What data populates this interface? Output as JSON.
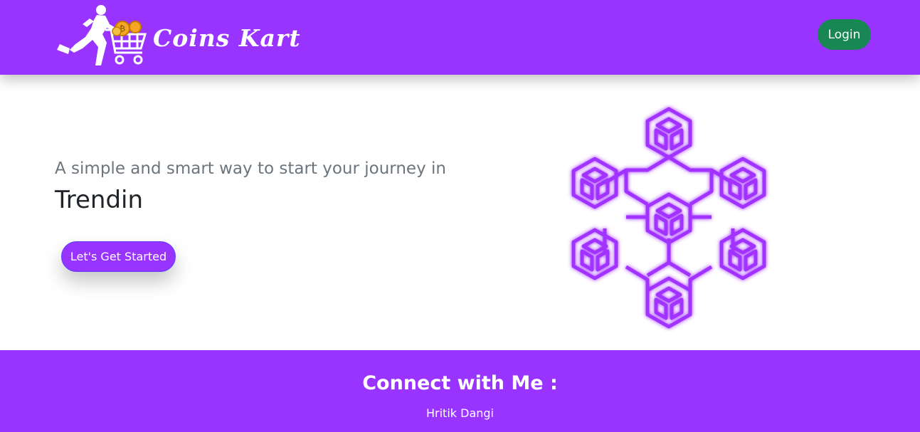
{
  "header": {
    "brand_name": "Coins Kart",
    "login_label": "Login",
    "colors": {
      "background": "#9933ff",
      "login": "#198754"
    }
  },
  "hero": {
    "tagline": "A simple and smart way to start your journey in",
    "typed_text": "Trendin",
    "cta_label": "Let's Get Started",
    "illustration_icon": "blockchain-cubes-icon",
    "colors": {
      "accent": "#9933ff",
      "illustration": "#a133ff"
    }
  },
  "footer": {
    "title": "Connect with Me :",
    "name": "Hritik Dangi",
    "colors": {
      "background": "#9933ff"
    }
  }
}
